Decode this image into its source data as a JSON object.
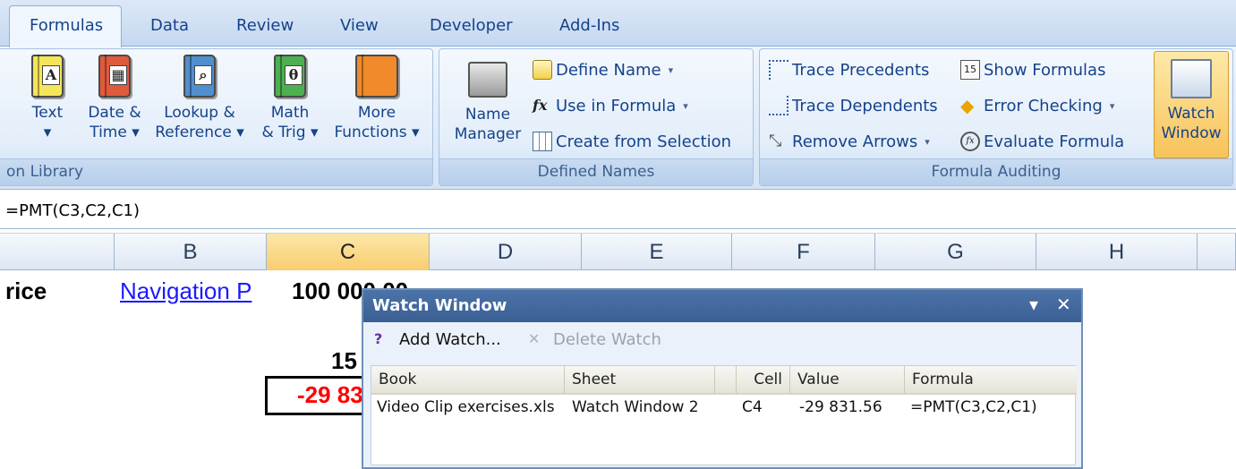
{
  "tabs": [
    "Formulas",
    "Data",
    "Review",
    "View",
    "Developer",
    "Add-Ins"
  ],
  "function_library": {
    "group_label": "on Library",
    "buttons": [
      {
        "label": "Text\n▾",
        "color": "#f4e55a",
        "glyph": "A"
      },
      {
        "label": "Date &\nTime ▾",
        "color": "#e05a3c",
        "glyph": "▦"
      },
      {
        "label": "Lookup &\nReference ▾",
        "color": "#4f8fd0",
        "glyph": "⌕"
      },
      {
        "label": "Math\n& Trig ▾",
        "color": "#4caf50",
        "glyph": "θ"
      },
      {
        "label": "More\nFunctions ▾",
        "color": "#f08a2a",
        "glyph": ""
      }
    ]
  },
  "defined_names": {
    "group_label": "Defined Names",
    "name_manager": "Name\nManager",
    "define_name": "Define Name",
    "use_in_formula": "Use in Formula",
    "create_from_selection": "Create from Selection"
  },
  "formula_auditing": {
    "group_label": "Formula Auditing",
    "trace_precedents": "Trace Precedents",
    "trace_dependents": "Trace Dependents",
    "remove_arrows": "Remove Arrows",
    "show_formulas": "Show Formulas",
    "error_checking": "Error Checking",
    "evaluate_formula": "Evaluate Formula",
    "watch_window": "Watch\nWindow"
  },
  "formula_bar": {
    "text": "=PMT(C3,C2,C1)"
  },
  "columns": [
    "B",
    "C",
    "D",
    "E",
    "F",
    "G",
    "H"
  ],
  "sheet": {
    "a1_partial": "rice",
    "b1": "Navigation P",
    "c1": "100 000,00",
    "c3_partial": "15",
    "c4_partial": "-29 83"
  },
  "watch_window": {
    "title": "Watch Window",
    "add_watch": "Add Watch...",
    "delete_watch": "Delete Watch",
    "headers": [
      "Book",
      "Sheet",
      "Cell",
      "Value",
      "Formula"
    ],
    "rows": [
      {
        "book": "Video Clip exercises.xls",
        "sheet": "Watch Window 2",
        "cell": "C4",
        "value": "-29 831.56",
        "formula": "=PMT(C3,C2,C1)"
      }
    ]
  },
  "colors": {
    "accent": "#15428b",
    "negative_value": "#ff0000",
    "link": "#1a1aff",
    "selected_column": "#f9cc70",
    "watch_title": "#3a5f94"
  }
}
